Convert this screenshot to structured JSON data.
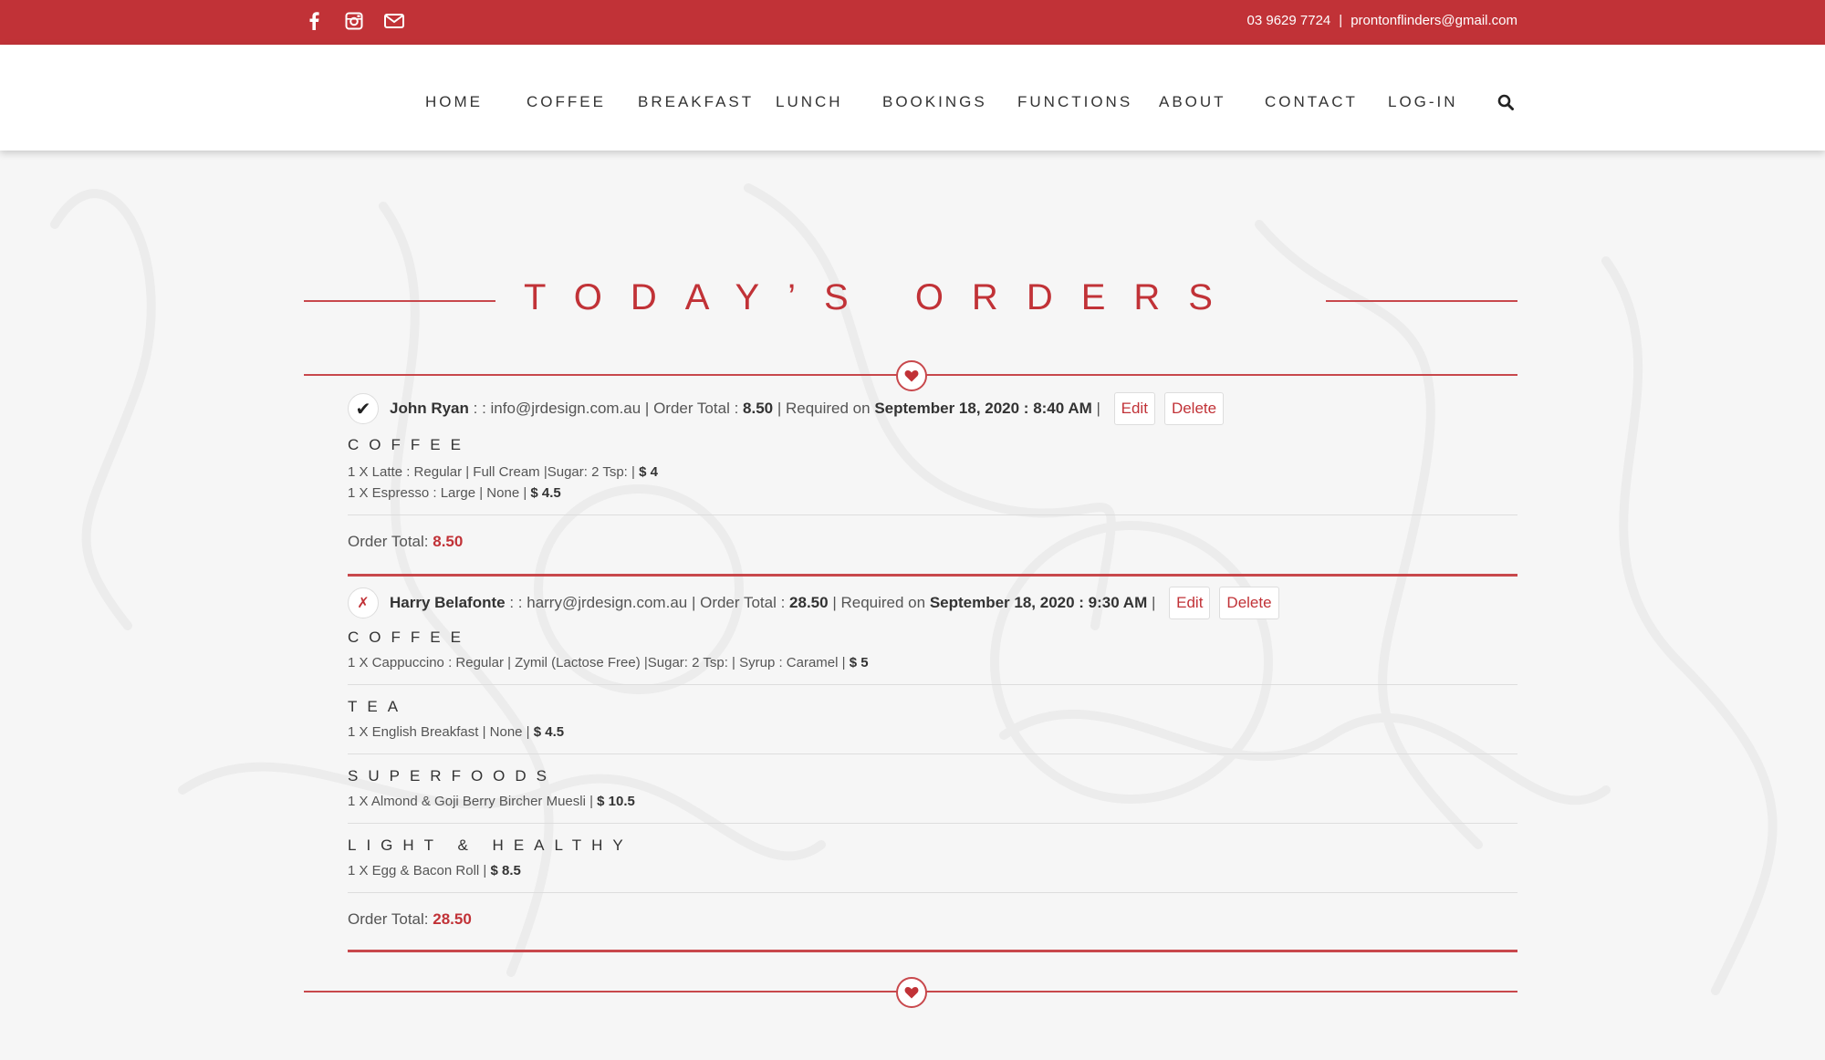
{
  "topbar": {
    "icons": [
      "facebook-icon",
      "instagram-icon",
      "mail-icon"
    ],
    "phone": "03 9629 7724",
    "separator": "|",
    "email": "prontonflinders@gmail.com"
  },
  "nav": {
    "items": [
      "HOME",
      "COFFEE",
      "BREAKFAST",
      "LUNCH",
      "BOOKINGS",
      "FUNCTIONS",
      "ABOUT",
      "CONTACT",
      "LOG-IN"
    ],
    "search_icon": "search-icon"
  },
  "page_title": "TODAY’S ORDERS",
  "orders": [
    {
      "status": "✔",
      "name": "John Ryan",
      "sep1": " : : ",
      "email": "info@jrdesign.com.au",
      "total_label": " | Order Total : ",
      "total": "8.50",
      "required_label": " | Required on ",
      "required": "September 18, 2020 : 8:40 AM",
      "end_sep": " | ",
      "edit": "Edit",
      "delete": "Delete",
      "categories": [
        {
          "title": "COFFEE",
          "items": [
            {
              "text": "1 X Latte : Regular | Full Cream |Sugar: 2 Tsp: | ",
              "price": "$ 4"
            },
            {
              "text": "1 X Espresso : Large | None | ",
              "price": "$ 4.5"
            }
          ]
        }
      ],
      "footer_label": "Order Total: ",
      "footer_total": "8.50"
    },
    {
      "status": "✗",
      "name": "Harry Belafonte",
      "sep1": " : : ",
      "email": "harry@jrdesign.com.au",
      "total_label": " | Order Total : ",
      "total": "28.50",
      "required_label": " | Required on ",
      "required": "September 18, 2020 : 9:30 AM",
      "end_sep": " | ",
      "edit": "Edit",
      "delete": "Delete",
      "categories": [
        {
          "title": "COFFEE",
          "items": [
            {
              "text": "1 X Cappuccino : Regular | Zymil (Lactose Free) |Sugar: 2 Tsp: | Syrup : Caramel | ",
              "price": "$ 5"
            }
          ]
        },
        {
          "title": "TEA",
          "items": [
            {
              "text": "1 X English Breakfast | None | ",
              "price": "$ 4.5"
            }
          ]
        },
        {
          "title": "SUPERFOODS",
          "items": [
            {
              "text": "1 X Almond & Goji Berry Bircher Muesli | ",
              "price": "$ 10.5"
            }
          ]
        },
        {
          "title": "LIGHT & HEALTHY",
          "items": [
            {
              "text": "1 X Egg & Bacon Roll | ",
              "price": "$ 8.5"
            }
          ]
        }
      ],
      "footer_label": "Order Total: ",
      "footer_total": "28.50"
    }
  ],
  "colors": {
    "brand_red": "#c13237",
    "line_red": "#c8484c",
    "background": "#f6f6f6"
  }
}
